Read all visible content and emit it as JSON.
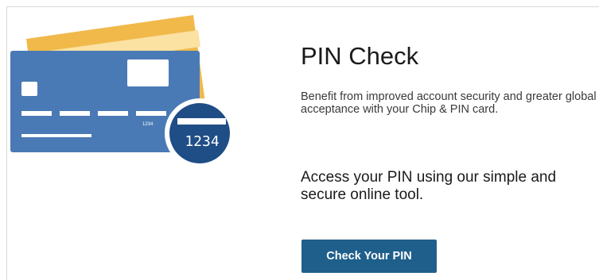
{
  "card_illustration": {
    "small_card_number": "1234",
    "badge_number": "1234"
  },
  "pin_check": {
    "title": "PIN Check",
    "benefit_text": "Benefit from improved account security and greater global acceptance with your Chip & PIN card.",
    "access_text": "Access your PIN using our simple and secure online tool.",
    "button_label": "Check Your PIN"
  },
  "colors": {
    "card_blue": "#4a7ab5",
    "card_gold": "#f0b94a",
    "badge_navy": "#1f4d86",
    "button_blue": "#1f5f8b"
  }
}
